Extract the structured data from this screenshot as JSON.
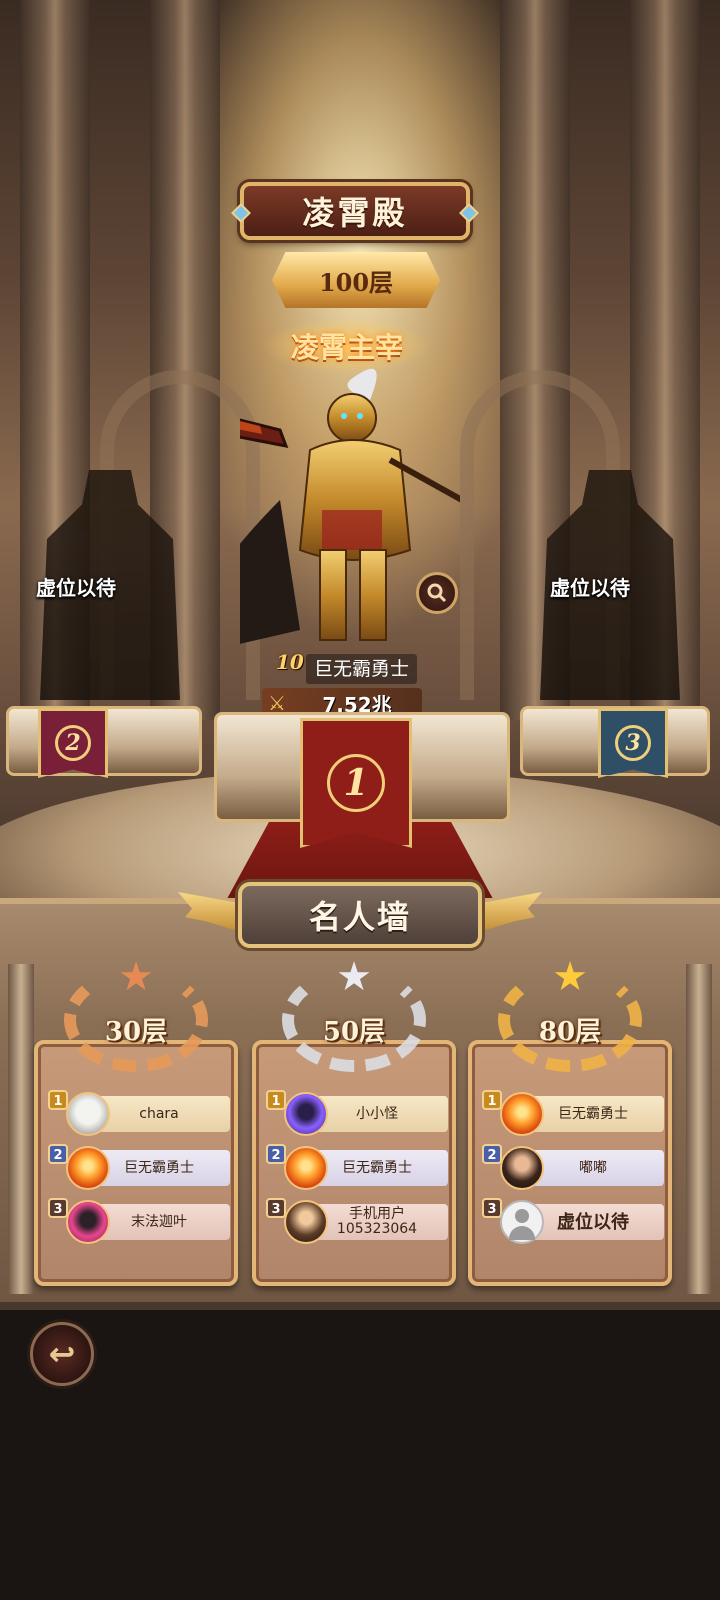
{
  "header": {
    "title": "凌霄殿",
    "floor_badge": "100层",
    "champion_title": "凌霄主宰"
  },
  "podium": {
    "first": {
      "level": "10",
      "name": "巨无霸勇士",
      "power": "7.52兆",
      "rank": "1"
    },
    "second": {
      "placeholder": "虚位以待",
      "rank": "2"
    },
    "third": {
      "placeholder": "虚位以待",
      "rank": "3"
    }
  },
  "hall_of_fame": {
    "title": "名人墙",
    "cards": [
      {
        "floor": "30层",
        "tier": "bronze",
        "entries": [
          {
            "rank": "1",
            "name": "chara",
            "avatar": "cat-avatar-icon"
          },
          {
            "rank": "2",
            "name": "巨无霸勇士",
            "avatar": "fire-avatar-icon"
          },
          {
            "rank": "3",
            "name": "末法迦叶",
            "avatar": "pink-avatar-icon"
          }
        ]
      },
      {
        "floor": "50层",
        "tier": "silver",
        "entries": [
          {
            "rank": "1",
            "name": "小小怪",
            "avatar": "purple-avatar-icon"
          },
          {
            "rank": "2",
            "name": "巨无霸勇士",
            "avatar": "fire-avatar-icon"
          },
          {
            "rank": "3",
            "name": "手机用户\n105323064",
            "avatar": "warrior-avatar-icon"
          }
        ]
      },
      {
        "floor": "80层",
        "tier": "gold",
        "entries": [
          {
            "rank": "1",
            "name": "巨无霸勇士",
            "avatar": "fire-avatar-icon"
          },
          {
            "rank": "2",
            "name": "嘟嘟",
            "avatar": "lady-avatar-icon"
          },
          {
            "rank": "3",
            "name": "虚位以待",
            "avatar": "empty-avatar-icon"
          }
        ]
      }
    ]
  },
  "colors": {
    "accent_gold": "#e3b677",
    "banner_red": "#8e1e17",
    "banner_blue": "#2f4f66",
    "banner_maroon": "#7a1f38"
  },
  "icons": {
    "search": "magnifier-icon",
    "back": "back-arrow-icon",
    "power": "crossed-swords-icon"
  }
}
